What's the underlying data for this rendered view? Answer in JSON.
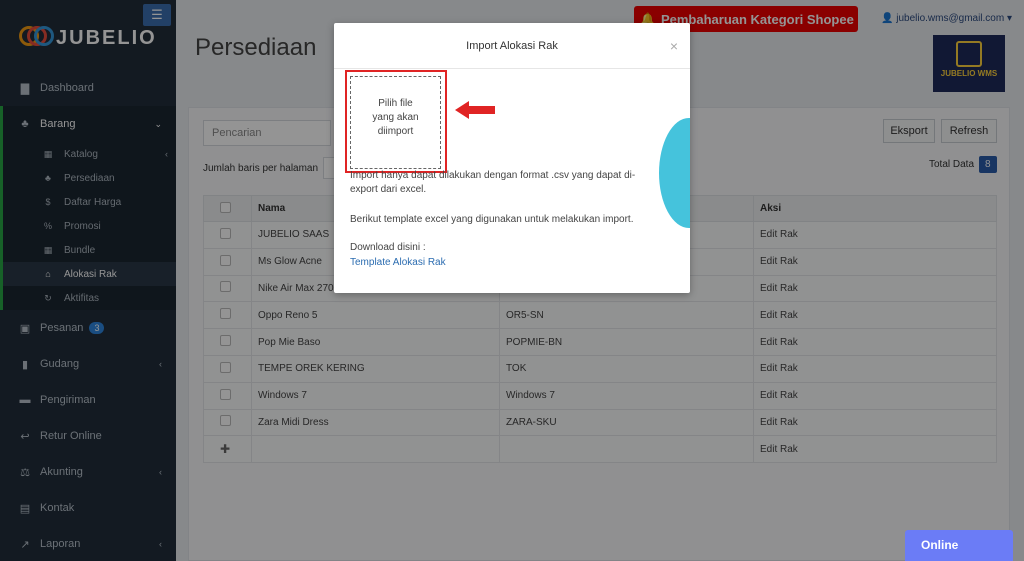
{
  "brand": {
    "name": "JUBELIO"
  },
  "sidebar": {
    "items": [
      {
        "label": "Dashboard",
        "icon": "chart-area-icon",
        "glyph": "▇"
      },
      {
        "label": "Barang",
        "icon": "cubes-icon",
        "glyph": "♣"
      }
    ],
    "barang_sub": [
      {
        "label": "Katalog",
        "icon": "grid-icon",
        "glyph": "▦"
      },
      {
        "label": "Persediaan",
        "icon": "cubes-icon",
        "glyph": "♣"
      },
      {
        "label": "Daftar Harga",
        "icon": "dollar-icon",
        "glyph": "$"
      },
      {
        "label": "Promosi",
        "icon": "percent-icon",
        "glyph": "%"
      },
      {
        "label": "Bundle",
        "icon": "boxes-icon",
        "glyph": "▦"
      },
      {
        "label": "Alokasi Rak",
        "icon": "bookmark-icon",
        "glyph": "⌂"
      },
      {
        "label": "Aktifitas",
        "icon": "history-icon",
        "glyph": "↻"
      }
    ],
    "rest": [
      {
        "label": "Pesanan",
        "icon": "basket-icon",
        "glyph": "▣",
        "badge": "3"
      },
      {
        "label": "Gudang",
        "icon": "building-icon",
        "glyph": "▮"
      },
      {
        "label": "Pengiriman",
        "icon": "truck-icon",
        "glyph": "▬"
      },
      {
        "label": "Retur Online",
        "icon": "reply-icon",
        "glyph": "↩"
      },
      {
        "label": "Akunting",
        "icon": "balance-icon",
        "glyph": "⚖"
      },
      {
        "label": "Kontak",
        "icon": "address-card-icon",
        "glyph": "▤"
      },
      {
        "label": "Laporan",
        "icon": "line-chart-icon",
        "glyph": "↗"
      }
    ]
  },
  "header": {
    "page_title": "Persediaan",
    "shopee_alert": "Pembaharuan Kategori Shopee",
    "user_email": "jubelio.wms@gmail.com",
    "wms_logo": "JUBELIO WMS"
  },
  "toolbar": {
    "search_placeholder": "Pencarian",
    "export_label": "Eksport",
    "refresh_label": "Refresh",
    "rows_label": "Jumlah baris per halaman",
    "total_label": "Total Data",
    "total_count": "8"
  },
  "table": {
    "columns": [
      "Nama",
      "",
      "Aksi"
    ],
    "rows": [
      {
        "name": "JUBELIO SAAS",
        "code": "",
        "action": "Edit Rak"
      },
      {
        "name": "Ms Glow Acne",
        "code": "",
        "action": "Edit Rak"
      },
      {
        "name": "Nike Air Max 270",
        "code": "",
        "action": "Edit Rak"
      },
      {
        "name": "Oppo Reno 5",
        "code": "OR5-SN",
        "action": "Edit Rak"
      },
      {
        "name": "Pop Mie Baso",
        "code": "POPMIE-BN",
        "action": "Edit Rak"
      },
      {
        "name": "TEMPE OREK KERING",
        "code": "TOK",
        "action": "Edit Rak"
      },
      {
        "name": "Windows 7",
        "code": "Windows 7",
        "action": "Edit Rak"
      },
      {
        "name": "Zara Midi Dress",
        "code": "ZARA-SKU",
        "action": "Edit Rak"
      }
    ],
    "add_row_action": "Edit Rak"
  },
  "modal": {
    "title": "Import Alokasi Rak",
    "close": "×",
    "dropzone_line1": "Pilih file",
    "dropzone_line2": "yang akan",
    "dropzone_line3": "diimport",
    "text1": "Import hanya dapat dilakukan dengan format .csv yang dapat di-export dari excel.",
    "text2": "Berikut template excel yang digunakan untuk melakukan import.",
    "text3": "Download disini :",
    "template_link": "Template Alokasi Rak"
  },
  "chat": {
    "label": "Online"
  },
  "colors": {
    "sidebar": "#212e3c",
    "accent": "#28a745",
    "alert": "#e00000",
    "link": "#2b6cb0",
    "highlight": "#e02424"
  }
}
